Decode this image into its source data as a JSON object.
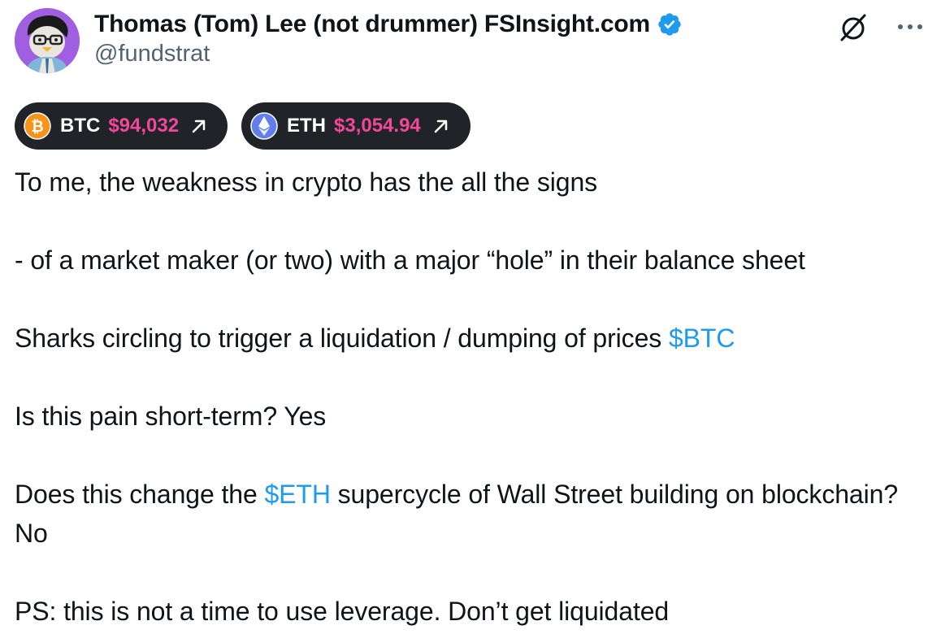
{
  "author": {
    "display_name": "Thomas (Tom) Lee (not drummer) FSInsight.com",
    "handle": "@fundstrat",
    "verified": true,
    "avatar_icon": "cartoon-penguin-avatar",
    "avatar_bg_color": "#a05ee0"
  },
  "header_icons": {
    "grok": "grok-icon",
    "more": "more-options-icon"
  },
  "tickers": [
    {
      "symbol": "BTC",
      "price": "$94,032",
      "icon": "bitcoin-icon",
      "trend_icon": "arrow-up-right-icon"
    },
    {
      "symbol": "ETH",
      "price": "$3,054.94",
      "icon": "ethereum-icon",
      "trend_icon": "arrow-up-right-icon"
    }
  ],
  "tweet": {
    "p1": "To me, the weakness in crypto has the all the signs",
    "p2": "- of a market maker (or two) with a major “hole” in their balance sheet",
    "p3_before": "Sharks circling to trigger a liquidation / dumping of prices ",
    "p3_cashtag": "$BTC",
    "p4": "Is this pain short-term? Yes",
    "p5_before": "Does this change the ",
    "p5_cashtag": "$ETH",
    "p5_after": " supercycle of Wall Street building on blockchain? No",
    "p6": "PS: this is not a time to use leverage. Don’t get liquidated"
  },
  "colors": {
    "text": "#0f1419",
    "secondary": "#536471",
    "link": "#1d9bf0",
    "price": "#f2479a",
    "pill_bg": "#202327",
    "verified_badge": "#1d9bf0",
    "btc_orange": "#f7931a",
    "eth_blue": "#627eea"
  }
}
